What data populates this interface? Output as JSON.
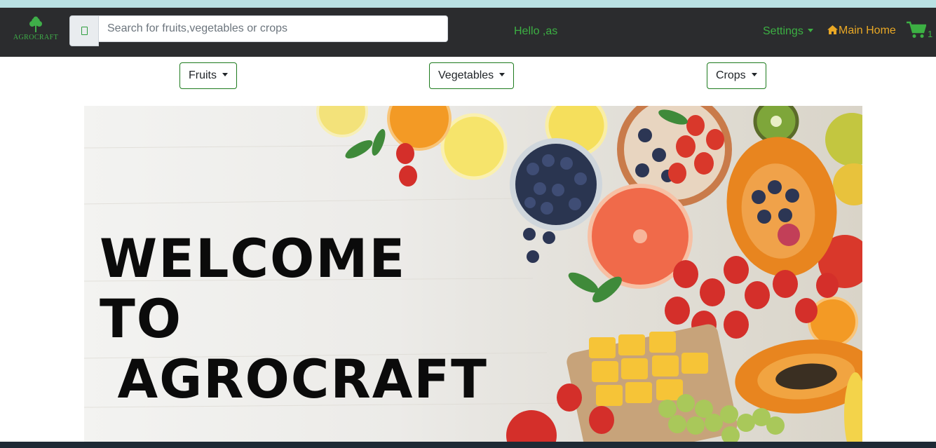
{
  "navbar": {
    "brand_text": "AGROCRAFT",
    "search_placeholder": "Search for fruits,vegetables or crops",
    "greeting": "Hello ,as",
    "settings_label": "Settings",
    "main_home_label": "Main Home",
    "cart_count": "1"
  },
  "categories": [
    {
      "label": "Fruits"
    },
    {
      "label": "Vegetables"
    },
    {
      "label": "Crops"
    }
  ],
  "hero": {
    "line1": "WELCOME TO",
    "line2": "AGROCRAFT"
  },
  "colors": {
    "navbar_bg": "#2b2c2e",
    "accent_green": "#3cb043",
    "home_orange": "#e9a825",
    "button_border_green": "#1e7b1e",
    "top_strip": "#b9e1e3"
  },
  "icons": [
    "tree-logo-icon",
    "search-icon",
    "caret-down-icon",
    "home-icon",
    "shopping-cart-icon"
  ]
}
